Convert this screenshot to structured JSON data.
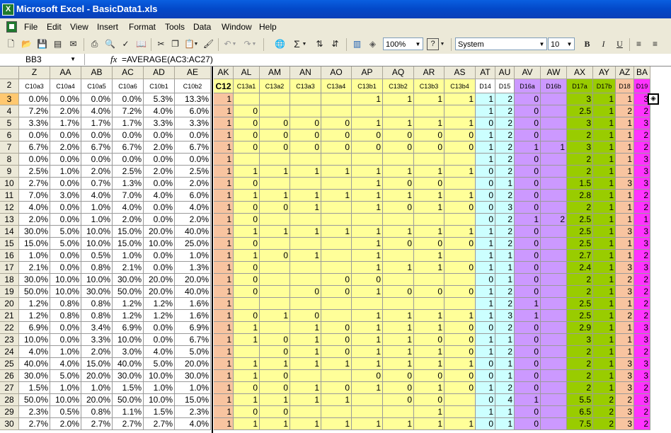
{
  "window": {
    "title": "Microsoft Excel - BasicData1.xls",
    "app_icon": "excel-app-icon"
  },
  "menu": [
    "File",
    "Edit",
    "View",
    "Insert",
    "Format",
    "Tools",
    "Data",
    "Window",
    "Help"
  ],
  "toolbar": {
    "zoom": "100%",
    "font": "System",
    "font_size": "10",
    "bold": "B",
    "italic": "I",
    "underline": "U",
    "sigma": "Σ"
  },
  "formula_bar": {
    "name_box": "BB3",
    "fx": "fx",
    "formula": "=AVERAGE(AC3:AC27)"
  },
  "colors": {
    "peach": "#f8c4a0",
    "yellow": "#ffff99",
    "lightblue": "#ccffff",
    "lavender": "#cc99ff",
    "green": "#99cc00",
    "magenta": "#ff33ff",
    "selected_header": "#ffc870"
  },
  "sheet": {
    "col_letters": [
      "Z",
      "AA",
      "AB",
      "AC",
      "AD",
      "AE",
      "AK",
      "AL",
      "AM",
      "AN",
      "AO",
      "AP",
      "AQ",
      "AR",
      "AS",
      "AT",
      "AU",
      "AV",
      "AW",
      "AX",
      "AY",
      "AZ",
      "BA"
    ],
    "row2_headers": [
      "C10a3",
      "C10a4",
      "C10a5",
      "C10a6",
      "C10b1",
      "C10b2",
      "C12",
      "C13a1",
      "C13a2",
      "C13a3",
      "C13a4",
      "C13b1",
      "C13b2",
      "C13b3",
      "C13b4",
      "D14",
      "D15",
      "D16a",
      "D16b",
      "D17a",
      "D17b",
      "D18",
      "D19"
    ],
    "rows": [
      {
        "n": "3",
        "v": [
          "0.0%",
          "0.0%",
          "0.0%",
          "0.0%",
          "5.3%",
          "13.3%",
          "1",
          "",
          "",
          "",
          "",
          "1",
          "1",
          "1",
          "1",
          "1",
          "2",
          "0",
          "",
          "3",
          "1",
          "1",
          "3"
        ]
      },
      {
        "n": "4",
        "v": [
          "7.2%",
          "2.0%",
          "4.0%",
          "7.2%",
          "4.0%",
          "6.0%",
          "1",
          "0",
          "",
          "",
          "",
          "",
          "",
          "",
          "",
          "1",
          "2",
          "0",
          "",
          "2.5",
          "1",
          "2",
          "2"
        ]
      },
      {
        "n": "5",
        "v": [
          "3.3%",
          "1.7%",
          "1.7%",
          "1.7%",
          "3.3%",
          "3.3%",
          "1",
          "0",
          "0",
          "0",
          "0",
          "1",
          "1",
          "1",
          "1",
          "0",
          "2",
          "0",
          "",
          "3",
          "1",
          "1",
          "3"
        ]
      },
      {
        "n": "6",
        "v": [
          "0.0%",
          "0.0%",
          "0.0%",
          "0.0%",
          "0.0%",
          "0.0%",
          "1",
          "0",
          "0",
          "0",
          "0",
          "0",
          "0",
          "0",
          "0",
          "1",
          "2",
          "0",
          "",
          "2",
          "1",
          "1",
          "2"
        ]
      },
      {
        "n": "7",
        "v": [
          "6.7%",
          "2.0%",
          "6.7%",
          "6.7%",
          "2.0%",
          "6.7%",
          "1",
          "0",
          "0",
          "0",
          "0",
          "0",
          "0",
          "0",
          "0",
          "1",
          "2",
          "1",
          "1",
          "3",
          "1",
          "1",
          "2"
        ]
      },
      {
        "n": "8",
        "v": [
          "0.0%",
          "0.0%",
          "0.0%",
          "0.0%",
          "0.0%",
          "0.0%",
          "1",
          "",
          "",
          "",
          "",
          "",
          "",
          "",
          "",
          "1",
          "2",
          "0",
          "",
          "2",
          "1",
          "1",
          "3"
        ]
      },
      {
        "n": "9",
        "v": [
          "2.5%",
          "1.0%",
          "2.0%",
          "2.5%",
          "2.0%",
          "2.5%",
          "1",
          "1",
          "1",
          "1",
          "1",
          "1",
          "1",
          "1",
          "1",
          "0",
          "2",
          "0",
          "",
          "2",
          "1",
          "1",
          "3"
        ]
      },
      {
        "n": "10",
        "v": [
          "2.7%",
          "0.0%",
          "0.7%",
          "1.3%",
          "0.0%",
          "2.0%",
          "1",
          "0",
          "",
          "",
          "",
          "1",
          "0",
          "0",
          "",
          "0",
          "1",
          "0",
          "",
          "1.5",
          "1",
          "3",
          "3"
        ]
      },
      {
        "n": "11",
        "v": [
          "7.0%",
          "3.0%",
          "4.0%",
          "7.0%",
          "4.0%",
          "6.0%",
          "1",
          "1",
          "1",
          "1",
          "1",
          "1",
          "1",
          "1",
          "1",
          "0",
          "2",
          "0",
          "",
          "2.8",
          "1",
          "1",
          "2"
        ]
      },
      {
        "n": "12",
        "v": [
          "4.0%",
          "0.0%",
          "1.0%",
          "4.0%",
          "0.0%",
          "4.0%",
          "1",
          "0",
          "0",
          "1",
          "",
          "1",
          "0",
          "1",
          "0",
          "0",
          "3",
          "0",
          "",
          "2",
          "1",
          "1",
          "2"
        ]
      },
      {
        "n": "13",
        "v": [
          "2.0%",
          "0.0%",
          "1.0%",
          "2.0%",
          "0.0%",
          "2.0%",
          "1",
          "0",
          "",
          "",
          "",
          "",
          "",
          "",
          "",
          "0",
          "2",
          "1",
          "2",
          "2.5",
          "1",
          "1",
          "1"
        ]
      },
      {
        "n": "14",
        "v": [
          "30.0%",
          "5.0%",
          "10.0%",
          "15.0%",
          "20.0%",
          "40.0%",
          "1",
          "1",
          "1",
          "1",
          "1",
          "1",
          "1",
          "1",
          "1",
          "1",
          "2",
          "0",
          "",
          "2.5",
          "1",
          "3",
          "3"
        ]
      },
      {
        "n": "15",
        "v": [
          "15.0%",
          "5.0%",
          "10.0%",
          "15.0%",
          "10.0%",
          "25.0%",
          "1",
          "0",
          "",
          "",
          "",
          "1",
          "0",
          "0",
          "0",
          "1",
          "2",
          "0",
          "",
          "2.5",
          "1",
          "1",
          "3"
        ]
      },
      {
        "n": "16",
        "v": [
          "1.0%",
          "0.0%",
          "0.5%",
          "1.0%",
          "0.0%",
          "1.0%",
          "1",
          "1",
          "0",
          "1",
          "",
          "1",
          "",
          "1",
          "",
          "1",
          "1",
          "0",
          "",
          "2.7",
          "1",
          "1",
          "2"
        ]
      },
      {
        "n": "17",
        "v": [
          "2.1%",
          "0.0%",
          "0.8%",
          "2.1%",
          "0.0%",
          "1.3%",
          "1",
          "0",
          "",
          "",
          "",
          "1",
          "1",
          "1",
          "0",
          "1",
          "1",
          "0",
          "",
          "2.4",
          "1",
          "3",
          "3"
        ]
      },
      {
        "n": "18",
        "v": [
          "30.0%",
          "10.0%",
          "10.0%",
          "30.0%",
          "20.0%",
          "20.0%",
          "1",
          "0",
          "",
          "",
          "0",
          "0",
          "",
          "",
          "",
          "0",
          "1",
          "0",
          "",
          "2",
          "1",
          "2",
          "2"
        ]
      },
      {
        "n": "19",
        "v": [
          "50.0%",
          "10.0%",
          "30.0%",
          "50.0%",
          "20.0%",
          "40.0%",
          "1",
          "0",
          "",
          "0",
          "0",
          "1",
          "0",
          "0",
          "0",
          "1",
          "2",
          "0",
          "",
          "2",
          "1",
          "3",
          "2"
        ]
      },
      {
        "n": "20",
        "v": [
          "1.2%",
          "0.8%",
          "0.8%",
          "1.2%",
          "1.2%",
          "1.6%",
          "1",
          "",
          "",
          "",
          "",
          "",
          "",
          "",
          "",
          "1",
          "2",
          "1",
          "",
          "2.5",
          "1",
          "1",
          "2"
        ]
      },
      {
        "n": "21",
        "v": [
          "1.2%",
          "0.8%",
          "0.8%",
          "1.2%",
          "1.2%",
          "1.6%",
          "1",
          "0",
          "1",
          "0",
          "",
          "1",
          "1",
          "1",
          "1",
          "1",
          "3",
          "1",
          "",
          "2.5",
          "1",
          "2",
          "2"
        ]
      },
      {
        "n": "22",
        "v": [
          "6.9%",
          "0.0%",
          "3.4%",
          "6.9%",
          "0.0%",
          "6.9%",
          "1",
          "1",
          "",
          "1",
          "0",
          "1",
          "1",
          "1",
          "0",
          "0",
          "2",
          "0",
          "",
          "2.9",
          "1",
          "1",
          "3"
        ]
      },
      {
        "n": "23",
        "v": [
          "10.0%",
          "0.0%",
          "3.3%",
          "10.0%",
          "0.0%",
          "6.7%",
          "1",
          "1",
          "0",
          "1",
          "0",
          "1",
          "1",
          "0",
          "0",
          "1",
          "1",
          "0",
          "",
          "3",
          "1",
          "1",
          "3"
        ]
      },
      {
        "n": "24",
        "v": [
          "4.0%",
          "1.0%",
          "2.0%",
          "3.0%",
          "4.0%",
          "5.0%",
          "1",
          "",
          "0",
          "1",
          "0",
          "1",
          "1",
          "1",
          "0",
          "1",
          "2",
          "0",
          "",
          "2",
          "1",
          "1",
          "2"
        ]
      },
      {
        "n": "25",
        "v": [
          "40.0%",
          "4.0%",
          "15.0%",
          "40.0%",
          "5.0%",
          "20.0%",
          "1",
          "1",
          "1",
          "1",
          "1",
          "1",
          "1",
          "1",
          "1",
          "0",
          "1",
          "0",
          "",
          "2",
          "1",
          "3",
          "3"
        ]
      },
      {
        "n": "26",
        "v": [
          "30.0%",
          "5.0%",
          "20.0%",
          "30.0%",
          "10.0%",
          "30.0%",
          "1",
          "1",
          "0",
          "",
          "",
          "0",
          "0",
          "0",
          "0",
          "0",
          "1",
          "0",
          "",
          "2",
          "1",
          "3",
          "3"
        ]
      },
      {
        "n": "27",
        "v": [
          "1.5%",
          "1.0%",
          "1.0%",
          "1.5%",
          "1.0%",
          "1.0%",
          "1",
          "0",
          "0",
          "1",
          "0",
          "1",
          "0",
          "1",
          "0",
          "1",
          "2",
          "0",
          "",
          "2",
          "1",
          "3",
          "2"
        ]
      },
      {
        "n": "28",
        "v": [
          "50.0%",
          "10.0%",
          "20.0%",
          "50.0%",
          "10.0%",
          "15.0%",
          "1",
          "1",
          "1",
          "1",
          "1",
          "",
          "0",
          "0",
          "",
          "0",
          "4",
          "1",
          "",
          "5.5",
          "2",
          "2",
          "3"
        ]
      },
      {
        "n": "29",
        "v": [
          "2.3%",
          "0.5%",
          "0.8%",
          "1.1%",
          "1.5%",
          "2.3%",
          "1",
          "0",
          "0",
          "",
          "",
          "",
          "",
          "1",
          "",
          "1",
          "1",
          "0",
          "",
          "6.5",
          "2",
          "3",
          "2"
        ]
      },
      {
        "n": "30",
        "v": [
          "2.7%",
          "2.0%",
          "2.7%",
          "2.7%",
          "2.7%",
          "4.0%",
          "1",
          "1",
          "1",
          "1",
          "1",
          "1",
          "1",
          "1",
          "1",
          "0",
          "1",
          "0",
          "",
          "7.5",
          "2",
          "3",
          "2"
        ]
      }
    ]
  }
}
